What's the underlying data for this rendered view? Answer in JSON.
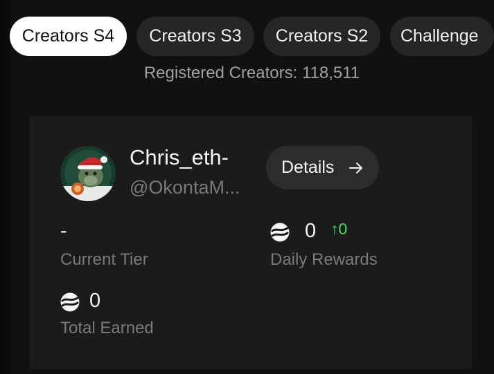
{
  "tabs": [
    {
      "label": "Creators S4",
      "active": true
    },
    {
      "label": "Creators S3",
      "active": false
    },
    {
      "label": "Creators S2",
      "active": false
    },
    {
      "label": "Challenge",
      "active": false
    }
  ],
  "registered_text": "Registered Creators: 118,511",
  "profile": {
    "name": "Chris_eth-",
    "handle": "@OkontaM...",
    "details_label": "Details"
  },
  "stats": {
    "tier": {
      "value": "-",
      "label": "Current Tier"
    },
    "daily": {
      "value": "0",
      "delta": "↑0",
      "label": "Daily Rewards"
    },
    "total": {
      "value": "0",
      "label": "Total Earned"
    }
  },
  "icons": {
    "coin": "coin-icon",
    "details_arrow": "arrow-right-icon"
  },
  "colors": {
    "positive_delta": "#3ddc5a",
    "active_tab_bg": "#ffffff",
    "tab_bg": "#262626"
  }
}
